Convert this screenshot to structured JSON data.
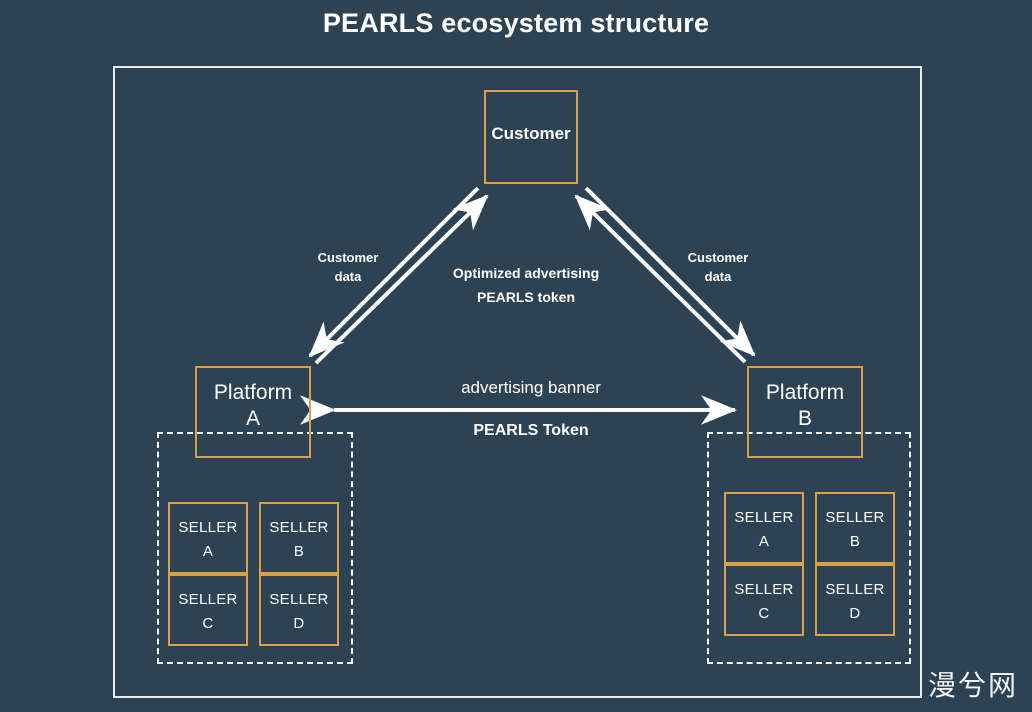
{
  "page": {
    "title": "PEARLS ecosystem structure",
    "background_color": "#2d4354",
    "frame_color": "#e9edf0",
    "node_border_color": "#d9a04a",
    "text_color": "#ffffff",
    "watermark": "漫兮网"
  },
  "nodes": {
    "customer": {
      "label": "Customer"
    },
    "platform_a": {
      "line1": "Platform",
      "line2": "A"
    },
    "platform_b": {
      "line1": "Platform",
      "line2": "B"
    }
  },
  "groups": {
    "platform_a_sellers": [
      {
        "line1": "SELLER",
        "line2": "A"
      },
      {
        "line1": "SELLER",
        "line2": "B"
      },
      {
        "line1": "SELLER",
        "line2": "C"
      },
      {
        "line1": "SELLER",
        "line2": "D"
      }
    ],
    "platform_b_sellers": [
      {
        "line1": "SELLER",
        "line2": "A"
      },
      {
        "line1": "SELLER",
        "line2": "B"
      },
      {
        "line1": "SELLER",
        "line2": "C"
      },
      {
        "line1": "SELLER",
        "line2": "D"
      }
    ]
  },
  "edge_labels": {
    "customer_data_left": "Customer\ndata",
    "customer_data_right": "Customer\ndata",
    "optimized_advertising": "Optimized advertising",
    "pearls_token_center": "PEARLS token",
    "advertising_banner": "advertising banner",
    "pearls_token_bottom": "PEARLS Token"
  }
}
